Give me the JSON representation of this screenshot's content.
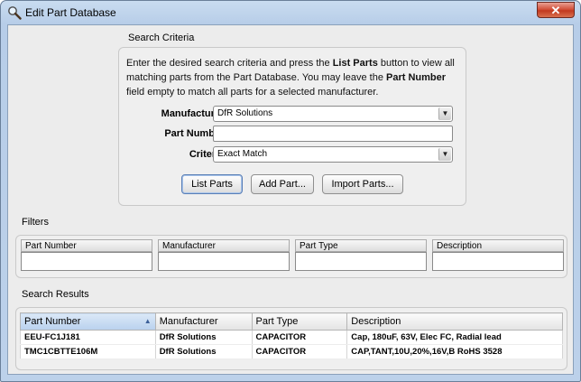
{
  "window": {
    "title": "Edit Part Database",
    "close_label": "✕"
  },
  "criteria": {
    "section_title": "Search Criteria",
    "instructions": [
      {
        "t": "Enter the desired search criteria and press the ",
        "b": false
      },
      {
        "t": "List Parts",
        "b": true
      },
      {
        "t": " button to view all matching parts from the Part Database. You may leave the ",
        "b": false
      },
      {
        "t": "Part Number",
        "b": true
      },
      {
        "t": " field empty to match all parts for a selected manufacturer.",
        "b": false
      }
    ],
    "manufacturer_label": "Manufacturer:",
    "manufacturer_value": "DfR Solutions",
    "part_number_label": "Part Number:",
    "part_number_value": "",
    "criteria_label": "Criteria:",
    "criteria_value": "Exact Match",
    "buttons": {
      "list": "List Parts",
      "add": "Add Part...",
      "import": "Import Parts..."
    }
  },
  "filters": {
    "section_title": "Filters",
    "columns": [
      "Part Number",
      "Manufacturer",
      "Part Type",
      "Description"
    ]
  },
  "results": {
    "section_title": "Search Results",
    "columns": [
      "Part Number",
      "Manufacturer",
      "Part Type",
      "Description"
    ],
    "sorted_column": "Part Number",
    "rows": [
      {
        "part_number": "EEU-FC1J181",
        "manufacturer": "DfR Solutions",
        "part_type": "CAPACITOR",
        "description": "Cap, 180uF, 63V, Elec FC, Radial lead"
      },
      {
        "part_number": "TMC1CBTTE106M",
        "manufacturer": "DfR Solutions",
        "part_type": "CAPACITOR",
        "description": "CAP,TANT,10U,20%,16V,B RoHS 3528"
      }
    ]
  }
}
